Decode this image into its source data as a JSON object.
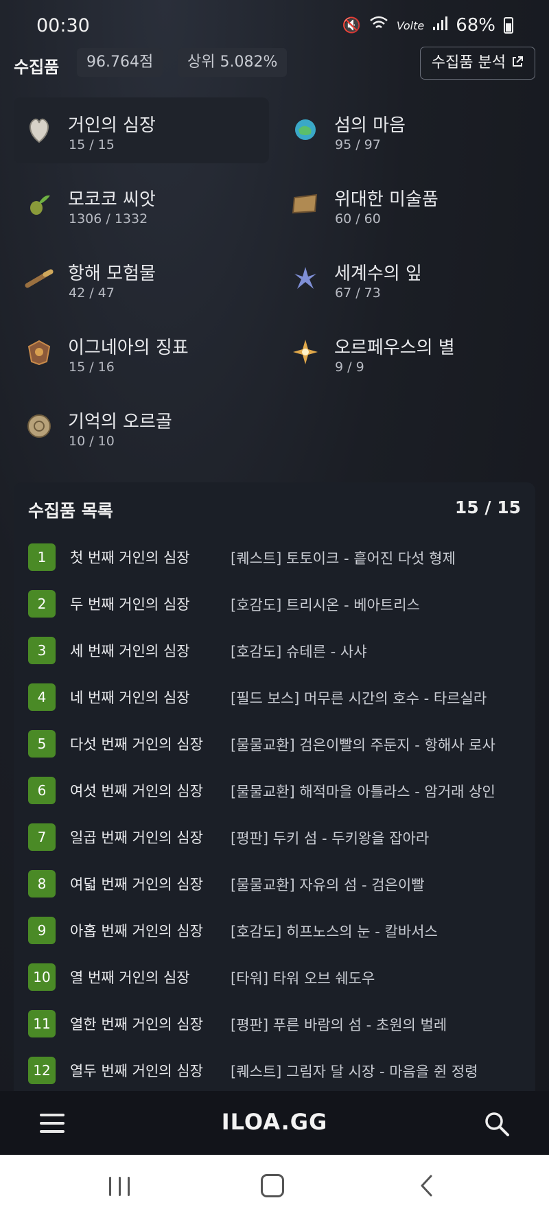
{
  "status_bar": {
    "time": "00:30",
    "network": "Volte",
    "battery": "68%"
  },
  "header": {
    "title": "수집품",
    "score": "96.764점",
    "rank": "상위 5.082%",
    "analysis_button": "수집품 분석"
  },
  "categories": [
    {
      "name": "거인의 심장",
      "count": "15 / 15",
      "icon": "giant-heart-icon",
      "active": true
    },
    {
      "name": "섬의 마음",
      "count": "95 / 97",
      "icon": "island-heart-icon"
    },
    {
      "name": "모코코 씨앗",
      "count": "1306 / 1332",
      "icon": "mokoko-seed-icon"
    },
    {
      "name": "위대한 미술품",
      "count": "60 / 60",
      "icon": "great-art-icon"
    },
    {
      "name": "항해 모험물",
      "count": "42 / 47",
      "icon": "voyage-item-icon"
    },
    {
      "name": "세계수의 잎",
      "count": "67 / 73",
      "icon": "world-tree-leaf-icon"
    },
    {
      "name": "이그네아의 징표",
      "count": "15 / 16",
      "icon": "ignea-token-icon"
    },
    {
      "name": "오르페우스의 별",
      "count": "9 / 9",
      "icon": "orpheus-star-icon"
    },
    {
      "name": "기억의 오르골",
      "count": "10 / 10",
      "icon": "memory-orgel-icon"
    }
  ],
  "list": {
    "title": "수집품 목록",
    "count": "15 / 15",
    "items": [
      {
        "num": "1",
        "name": "첫 번째 거인의 심장",
        "source": "[퀘스트] 토토이크 - 흩어진 다섯 형제"
      },
      {
        "num": "2",
        "name": "두 번째 거인의 심장",
        "source": "[호감도] 트리시온 - 베아트리스"
      },
      {
        "num": "3",
        "name": "세 번째 거인의 심장",
        "source": "[호감도] 슈테른 - 사샤"
      },
      {
        "num": "4",
        "name": "네 번째 거인의 심장",
        "source": "[필드 보스] 머무른 시간의 호수 - 타르실라"
      },
      {
        "num": "5",
        "name": "다섯 번째 거인의 심장",
        "source": "[물물교환] 검은이빨의 주둔지 - 항해사 로사"
      },
      {
        "num": "6",
        "name": "여섯 번째 거인의 심장",
        "source": "[물물교환] 해적마을 아틀라스 - 암거래 상인"
      },
      {
        "num": "7",
        "name": "일곱 번째 거인의 심장",
        "source": "[평판] 두키 섬 - 두키왕을 잡아라"
      },
      {
        "num": "8",
        "name": "여덟 번째 거인의 심장",
        "source": "[물물교환] 자유의 섬 - 검은이빨"
      },
      {
        "num": "9",
        "name": "아홉 번째 거인의 심장",
        "source": "[호감도] 히프노스의 눈 - 칼바서스"
      },
      {
        "num": "10",
        "name": "열 번째 거인의 심장",
        "source": "[타워] 타워 오브 쉐도우"
      },
      {
        "num": "11",
        "name": "열한 번째 거인의 심장",
        "source": "[평판] 푸른 바람의 섬 - 초원의 벌레"
      },
      {
        "num": "12",
        "name": "열두 번째 거인의 심장",
        "source": "[퀘스트] 그림자 달 시장 - 마음을 쥔 정령"
      }
    ]
  },
  "appbar": {
    "logo": "ILOA.GG"
  },
  "colors": {
    "badge_green": "#4a8a26",
    "panel_bg": "#1b1f27",
    "page_bg": "#15171d"
  }
}
